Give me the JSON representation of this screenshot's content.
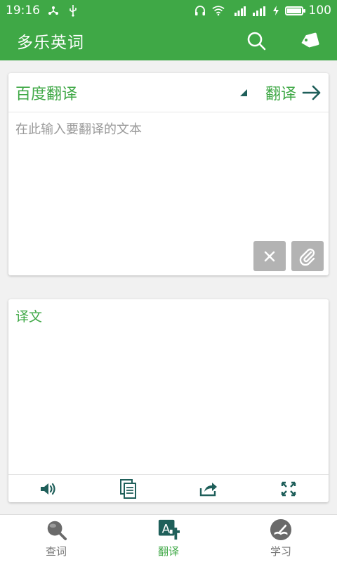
{
  "status_bar": {
    "time": "19:16",
    "battery": "100",
    "network": "4G"
  },
  "app": {
    "title": "多乐英词"
  },
  "input": {
    "engine": "百度翻译",
    "translate_label": "翻译",
    "placeholder": "在此输入要翻译的文本"
  },
  "output": {
    "label": "译文"
  },
  "nav": {
    "items": [
      {
        "label": "查词",
        "icon": "magnifier-icon"
      },
      {
        "label": "翻译",
        "icon": "translate-icon"
      },
      {
        "label": "学习",
        "icon": "study-icon"
      }
    ],
    "active_index": 1
  },
  "colors": {
    "primary": "#3fa846",
    "accent": "#1f5f5a",
    "gray_button": "#b3b3b3"
  }
}
